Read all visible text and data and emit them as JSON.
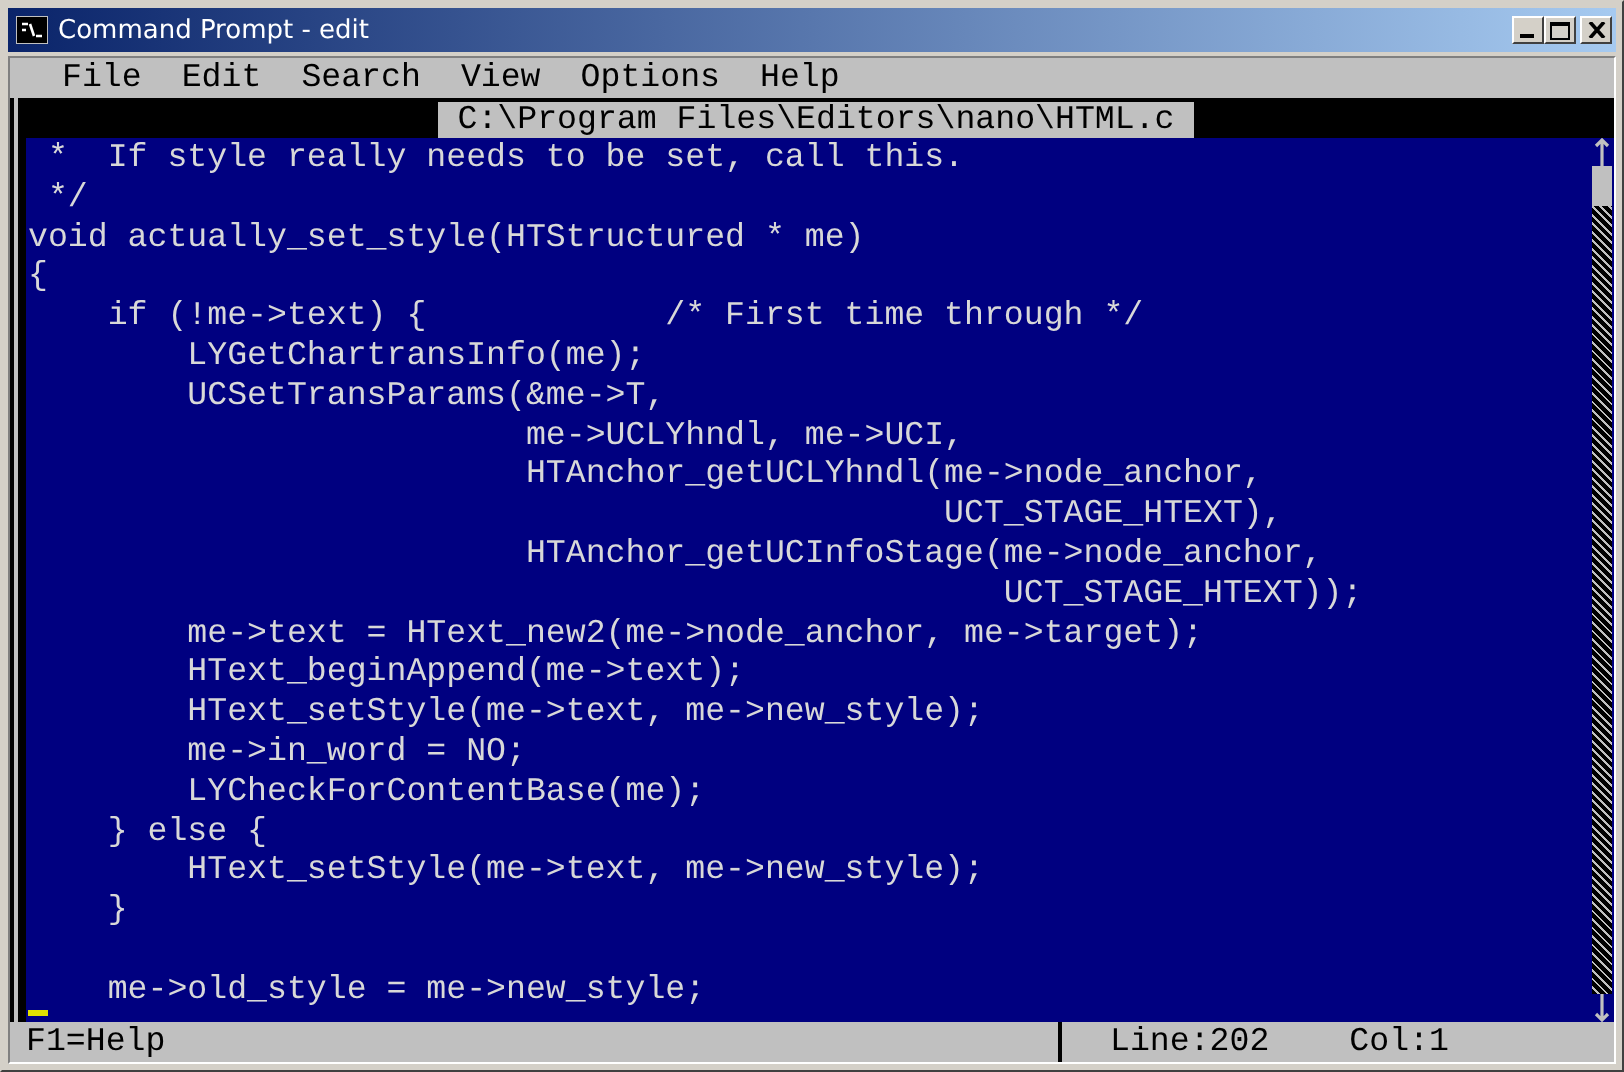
{
  "window": {
    "title": "Command Prompt - edit"
  },
  "menu": [
    "File",
    "Edit",
    "Search",
    "View",
    "Options",
    "Help"
  ],
  "file_tab": {
    "title": "C:\\Program Files\\Editors\\nano\\HTML.c"
  },
  "editor": {
    "lines": [
      {
        "kind": "code",
        "text": " *  If style really needs to be set, call this."
      },
      {
        "kind": "code",
        "text": " */"
      },
      {
        "kind": "code",
        "text": "void actually_set_style(HTStructured * me)"
      },
      {
        "kind": "code",
        "text": "{"
      },
      {
        "kind": "code",
        "text": "    if (!me->text) {            /* First time through */"
      },
      {
        "kind": "code",
        "text": "        LYGetChartransInfo(me);"
      },
      {
        "kind": "code",
        "text": "        UCSetTransParams(&me->T,"
      },
      {
        "kind": "code",
        "text": "                         me->UCLYhndl, me->UCI,"
      },
      {
        "kind": "code",
        "text": "                         HTAnchor_getUCLYhndl(me->node_anchor,"
      },
      {
        "kind": "code",
        "text": "                                              UCT_STAGE_HTEXT),"
      },
      {
        "kind": "code",
        "text": "                         HTAnchor_getUCInfoStage(me->node_anchor,"
      },
      {
        "kind": "code",
        "text": "                                                 UCT_STAGE_HTEXT));"
      },
      {
        "kind": "code",
        "text": "        me->text = HText_new2(me->node_anchor, me->target);"
      },
      {
        "kind": "code",
        "text": "        HText_beginAppend(me->text);"
      },
      {
        "kind": "code",
        "text": "        HText_setStyle(me->text, me->new_style);"
      },
      {
        "kind": "code",
        "text": "        me->in_word = NO;"
      },
      {
        "kind": "code",
        "text": "        LYCheckForContentBase(me);"
      },
      {
        "kind": "code",
        "text": "    } else {"
      },
      {
        "kind": "code",
        "text": "        HText_setStyle(me->text, me->new_style);"
      },
      {
        "kind": "code",
        "text": "    }"
      },
      {
        "kind": "blank"
      },
      {
        "kind": "code",
        "text": "    me->old_style = me->new_style;"
      }
    ]
  },
  "status_bar": {
    "help": "F1=Help",
    "line": "Line:202",
    "column": "Col:1"
  }
}
